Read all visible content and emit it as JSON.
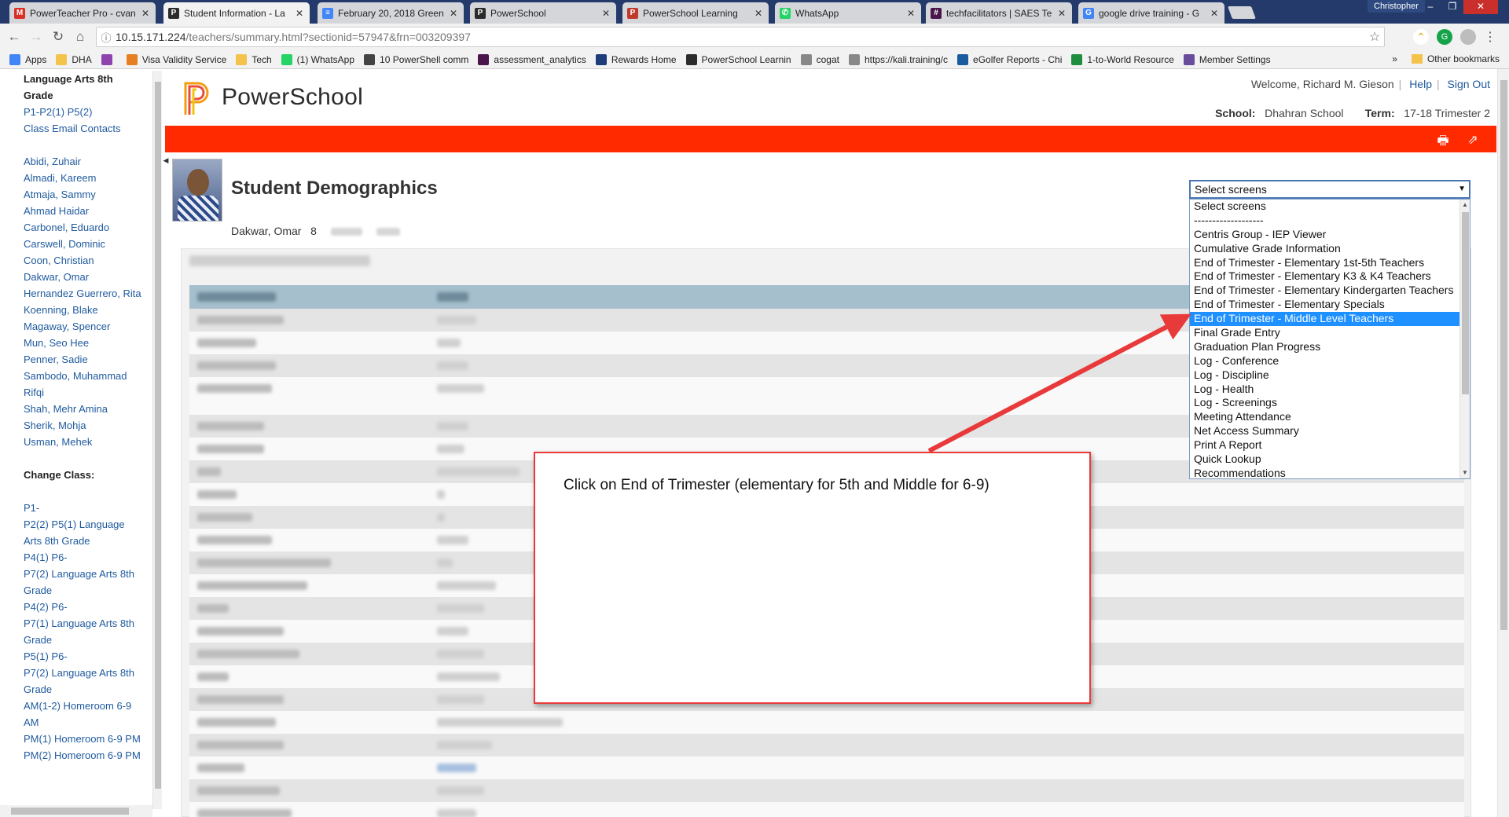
{
  "browser": {
    "tabs": [
      {
        "label": "PowerTeacher Pro - cvan",
        "icon": "gmail-icon",
        "color": "#d93025",
        "glyph": "M",
        "active": false
      },
      {
        "label": "Student Information - La",
        "icon": "powerschool-icon",
        "color": "#2b2b2b",
        "glyph": "P",
        "active": true
      },
      {
        "label": "February 20, 2018 Green",
        "icon": "google-docs-icon",
        "color": "#4285f4",
        "glyph": "≡",
        "active": false
      },
      {
        "label": "PowerSchool",
        "icon": "powerschool-icon",
        "color": "#2b2b2b",
        "glyph": "P",
        "active": false
      },
      {
        "label": "PowerSchool Learning",
        "icon": "powerschool-learning-icon",
        "color": "#c0392b",
        "glyph": "P",
        "active": false
      },
      {
        "label": "WhatsApp",
        "icon": "whatsapp-icon",
        "color": "#25d366",
        "glyph": "✆",
        "active": false
      },
      {
        "label": "techfacilitators | SAES Te",
        "icon": "slack-icon",
        "color": "#4a154b",
        "glyph": "#",
        "active": false
      },
      {
        "label": "google drive training - G",
        "icon": "google-icon",
        "color": "#4285f4",
        "glyph": "G",
        "active": false
      }
    ],
    "profile_name": "Christopher",
    "url_host": "10.15.171.224",
    "url_path": "/teachers/summary.html?sectionid=57947&frn=003209397",
    "bookmarks": [
      {
        "label": "Apps",
        "icon": "apps-grid-icon",
        "color": "#4285f4"
      },
      {
        "label": "DHA",
        "icon": "folder-icon",
        "color": "#f3c34b"
      },
      {
        "label": "",
        "icon": "chart-icon",
        "color": "#8e44ad"
      },
      {
        "label": "Visa Validity Service",
        "icon": "orange-dot-icon",
        "color": "#e67e22"
      },
      {
        "label": "Tech",
        "icon": "folder-icon",
        "color": "#f3c34b"
      },
      {
        "label": "(1) WhatsApp",
        "icon": "whatsapp-icon",
        "color": "#25d366"
      },
      {
        "label": "10 PowerShell comm",
        "icon": "powershell-icon",
        "color": "#444444"
      },
      {
        "label": "assessment_analytics",
        "icon": "slack-icon",
        "color": "#4a154b"
      },
      {
        "label": "Rewards Home",
        "icon": "rewards-icon",
        "color": "#1d3c7a"
      },
      {
        "label": "PowerSchool Learnin",
        "icon": "powerschool-icon",
        "color": "#2b2b2b"
      },
      {
        "label": "cogat",
        "icon": "page-icon",
        "color": "#888888"
      },
      {
        "label": "https://kali.training/c",
        "icon": "page-icon",
        "color": "#888888"
      },
      {
        "label": "eGolfer Reports - Chi",
        "icon": "power-icon",
        "color": "#1a5a9e"
      },
      {
        "label": "1-to-World Resource",
        "icon": "sheet-icon",
        "color": "#1e8e3e"
      },
      {
        "label": "Member Settings",
        "icon": "member-icon",
        "color": "#6a4c9c"
      }
    ],
    "other_bookmarks": "Other bookmarks",
    "overflow": "»"
  },
  "sidebar": {
    "class_title": "Language Arts 8th Grade",
    "period": "P1-P2(1) P5(2)",
    "class_email": "Class Email Contacts",
    "students": [
      "Abidi, Zuhair",
      "Almadi, Kareem",
      "Atmaja, Sammy",
      "Ahmad Haidar",
      "Carbonel, Eduardo",
      "Carswell, Dominic",
      "Coon, Christian",
      "Dakwar, Omar",
      "Hernandez Guerrero, Rita",
      "Koenning, Blake",
      "Magaway, Spencer",
      "Mun, Seo Hee",
      "Penner, Sadie",
      "Sambodo, Muhammad Rifqi",
      "Shah, Mehr Amina",
      "Sherik, Mohja",
      "Usman, Mehek"
    ],
    "change_class_label": "Change Class:",
    "classes": [
      "P1-",
      "P2(2) P5(1) Language Arts 8th Grade",
      "P4(1) P6-",
      "P7(2) Language Arts 8th Grade",
      "P4(2) P6-",
      "P7(1) Language Arts 8th Grade",
      "P5(1) P6-",
      "P7(2) Language Arts 8th Grade",
      "AM(1-2) Homeroom 6-9 AM",
      "PM(1) Homeroom 6-9 PM",
      "PM(2) Homeroom 6-9 PM"
    ]
  },
  "header": {
    "brand": "PowerSchool",
    "welcome": "Welcome, Richard M. Gieson",
    "help": "Help",
    "sign_out": "Sign Out",
    "school_label": "School:",
    "school_value": "Dhahran School",
    "term_label": "Term:",
    "term_value": "17-18 Trimester 2",
    "brand_color": "#ff2a00"
  },
  "student": {
    "page_title": "Student Demographics",
    "name": "Dakwar, Omar",
    "grade": "8"
  },
  "screens_select": {
    "selected": "Select screens",
    "options": [
      "Select screens",
      "-------------------",
      "Centris Group - IEP Viewer",
      "Cumulative Grade Information",
      "End of Trimester - Elementary 1st-5th Teachers",
      "End of Trimester - Elementary K3 & K4 Teachers",
      "End of Trimester - Elementary Kindergarten Teachers",
      "End of Trimester - Elementary Specials",
      "End of Trimester - Middle Level Teachers",
      "Final Grade Entry",
      "Graduation Plan Progress",
      "Log - Conference",
      "Log - Discipline",
      "Log - Health",
      "Log - Screenings",
      "Meeting Attendance",
      "Net Access Summary",
      "Print A Report",
      "Quick Lookup",
      "Recommendations"
    ],
    "highlighted": "End of Trimester - Middle Level Teachers",
    "highlight_color": "#1e90ff"
  },
  "annotation": {
    "text": "Click on End of Trimester (elementary for 5th and Middle for 6-9)",
    "color": "#e83a3a"
  }
}
